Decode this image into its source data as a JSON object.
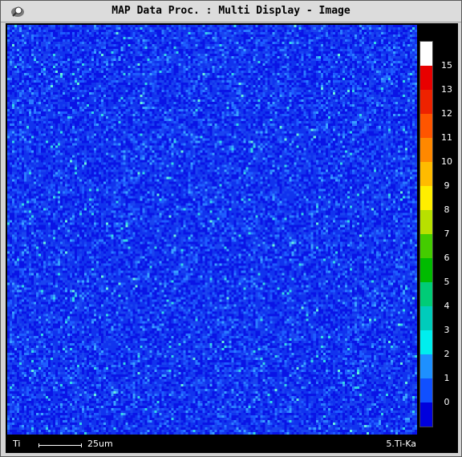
{
  "window": {
    "title": "MAP Data Proc. : Multi Display - Image",
    "icon": "magnifier-icon"
  },
  "map": {
    "element_label": "Ti",
    "channel_label": "5.Ti-Ka",
    "scale_label": "25um",
    "background_color": "#1133ee",
    "typical_level": 1
  },
  "colorbar": {
    "labels": [
      "15",
      "13",
      "12",
      "11",
      "10",
      "9",
      "8",
      "7",
      "6",
      "5",
      "4",
      "3",
      "2",
      "1",
      "0"
    ],
    "colors": [
      "#ffffff",
      "#e80000",
      "#ee2200",
      "#ff5500",
      "#ff8800",
      "#ffbb00",
      "#ffee00",
      "#b8e000",
      "#44cc00",
      "#00bb00",
      "#00cc77",
      "#00ccbb",
      "#00eeee",
      "#1e90ff",
      "#1050ff",
      "#0000dd"
    ]
  }
}
